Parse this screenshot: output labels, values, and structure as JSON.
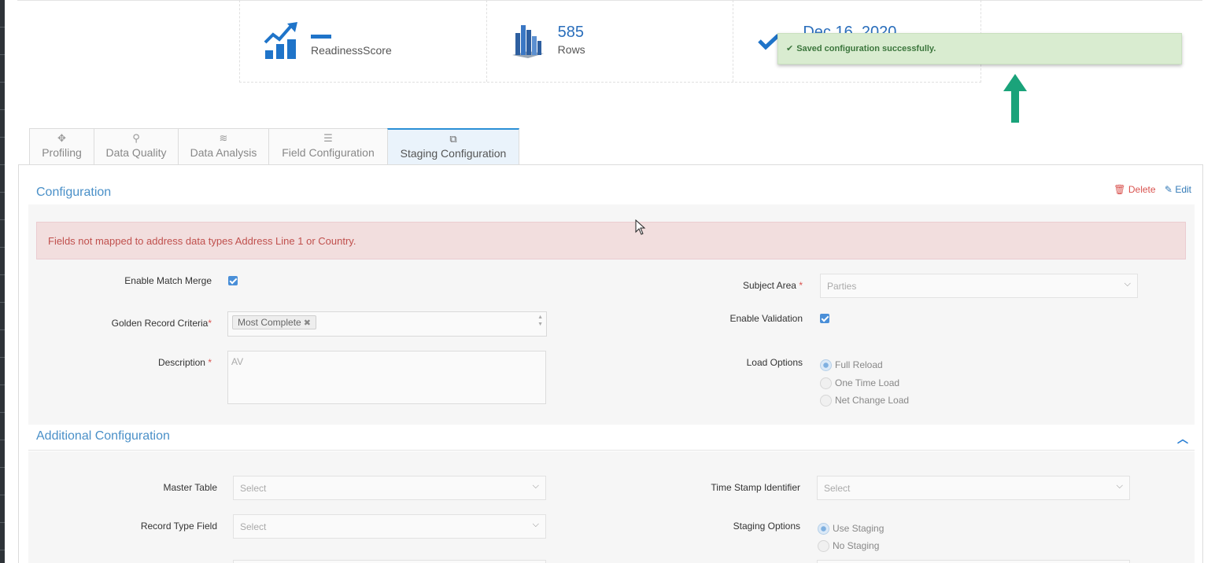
{
  "stats": [
    {
      "value": "",
      "label": "ReadinessScore",
      "icon": "chart-growth-icon"
    },
    {
      "value": "585",
      "label": "Rows",
      "icon": "bar-building-icon"
    },
    {
      "value": "Dec 16, 2020",
      "label": "",
      "icon": "checkmark-icon"
    }
  ],
  "toast": {
    "message": "Saved configuration successfully.",
    "icon": "check-icon"
  },
  "tabs": [
    {
      "label": "Profiling",
      "icon": "crosshair-icon"
    },
    {
      "label": "Data Quality",
      "icon": "magnify-check-icon"
    },
    {
      "label": "Data Analysis",
      "icon": "stack-icon"
    },
    {
      "label": "Field Configuration",
      "icon": "sliders-icon"
    },
    {
      "label": "Staging Configuration",
      "icon": "copy-icon"
    }
  ],
  "configuration": {
    "title": "Configuration",
    "delete_label": "Delete",
    "edit_label": "Edit",
    "alert": "Fields not mapped to address data types Address Line 1 or Country.",
    "enable_match_merge_label": "Enable Match Merge",
    "golden_record_label": "Golden Record Criteria",
    "golden_record_chip": "Most Complete",
    "description_label": "Description",
    "description_value": "AV",
    "subject_area_label": "Subject Area",
    "subject_area_value": "Parties",
    "enable_validation_label": "Enable Validation",
    "load_options_label": "Load Options",
    "load_options": [
      "Full Reload",
      "One Time Load",
      "Net Change Load"
    ]
  },
  "additional": {
    "title": "Additional Configuration",
    "master_table_label": "Master Table",
    "master_table_value": "Select",
    "record_type_label": "Record Type Field",
    "record_type_value": "Select",
    "timestamp_label": "Time Stamp Identifier",
    "timestamp_value": "Select",
    "staging_options_label": "Staging Options",
    "staging_options": [
      "Use Staging",
      "No Staging"
    ]
  },
  "colors": {
    "accent": "#2a8fd6",
    "annotation_arrow": "#1aa37a",
    "alert_bg": "#f2dede",
    "toast_bg": "#d9ecd0"
  }
}
